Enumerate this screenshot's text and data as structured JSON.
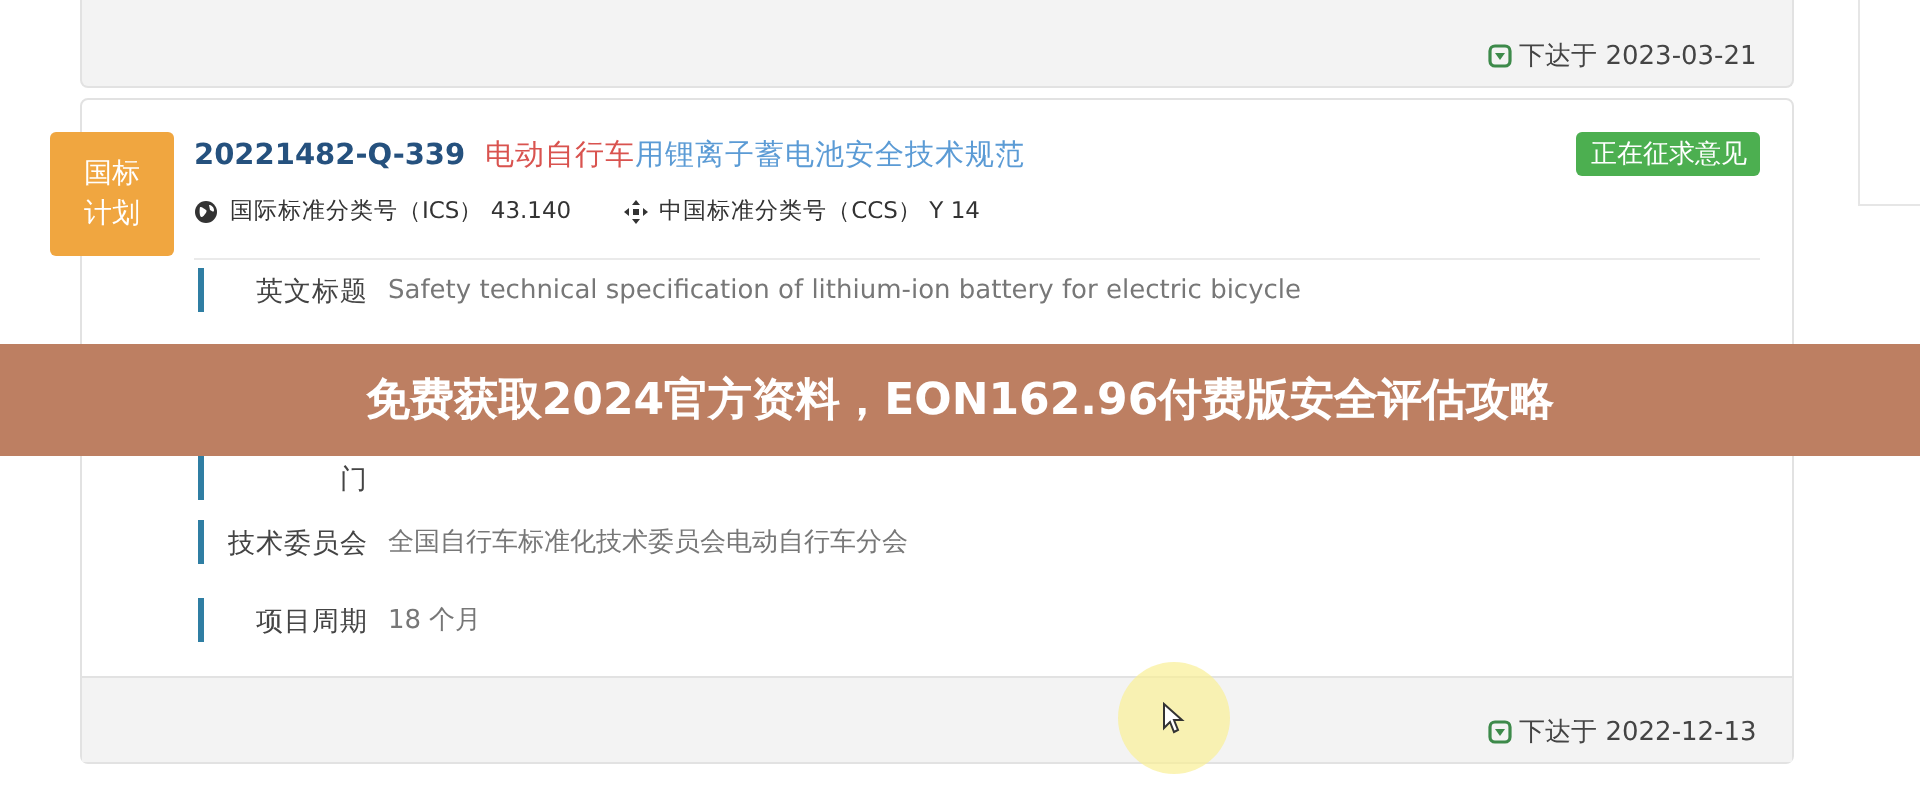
{
  "previous_card": {
    "footer_date": "下达于 2023-03-21"
  },
  "card": {
    "badge": "国标计划",
    "code": "20221482-Q-339",
    "title_parts": [
      {
        "text": "电动自行车",
        "kind": "highlight"
      },
      {
        "text": "用锂离子蓄电池安全技术规范",
        "kind": "link"
      }
    ],
    "status": "正在征求意见",
    "meta": [
      {
        "kind": "globe",
        "text": "国际标准分类号（ICS）  43.140"
      },
      {
        "kind": "cross",
        "text": "中国标准分类号（CCS）  Y 14"
      }
    ],
    "fields": [
      {
        "label": "英文标题",
        "value": "Safety technical specification of lithium-ion battery for electric bicycle"
      },
      {
        "kind": "covered"
      },
      {
        "kind": "tail",
        "label": "门"
      },
      {
        "label": "技术委员会",
        "value": "全国自行车标准化技术委员会电动自行车分会"
      },
      {
        "label": "项目周期",
        "value": "18 个月"
      }
    ],
    "footer_date": "下达于 2022-12-13"
  },
  "banner": {
    "title": "免费获取2024官方资料，EON162.96付费版安全评估攻略"
  }
}
